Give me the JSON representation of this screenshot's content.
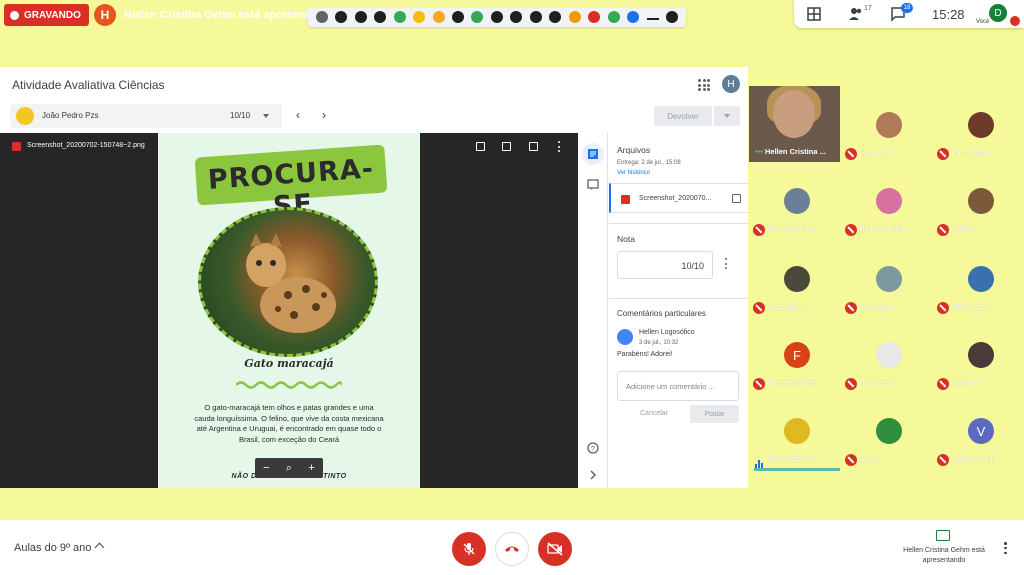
{
  "top_bar": {
    "recording_label": "GRAVANDO",
    "presenter_initial": "H",
    "presenting_text": "Hellen Cristina Gehm está apresentando",
    "participants_count": "17",
    "chat_count": "18",
    "time": "15:28",
    "you_initial": "D",
    "you_label": "Você"
  },
  "classroom": {
    "title": "Atividade Avaliativa Ciências",
    "account_initial": "H",
    "student_name": "João Pedro Pzs",
    "student_grade": "10/10",
    "return_label": "Devolver"
  },
  "viewer": {
    "file_name": "Screenshot_20200702-150748~2.png",
    "poster_title": "PROCURA-SE",
    "poster_subtitle": "Gato maracajá",
    "poster_text": "O gato-maracajá tem olhos e patas grandes e uma cauda longuíssima. O felino, que vive da costa mexicana até Argentina e Uruguai, é encontrado em quase todo o Brasil, com exceção do Ceará",
    "poster_footer": "NÃO DEIXE ELE SER EXTINTO",
    "zoom_out": "−",
    "zoom_icon": "⌕",
    "zoom_in": "+"
  },
  "panel": {
    "files_heading": "Arquivos",
    "delivered": "Entrega: 2 de jul., 15:08",
    "history_link": "Ver histórico",
    "file_chip_name": "Screenshot_2020070...",
    "grade_heading": "Nota",
    "grade_value": "10/10",
    "comments_heading": "Comentários particulares",
    "comment_author": "Hellen Logosófico",
    "comment_date": "3 de jul., 10:32",
    "comment_text": "Parabéns! Adorei!",
    "comment_placeholder": "Adicione um comentário ...",
    "cancel_label": "Cancelar",
    "post_label": "Postar"
  },
  "self_tile": {
    "name": "Hellen Cristina ..."
  },
  "participants": [
    {
      "name": "Hugo Pilar",
      "muted": true,
      "color": "#b07a5a"
    },
    {
      "name": "Paulo Maria",
      "muted": true,
      "color": "#6e3a2a"
    },
    {
      "name": "Fernanda Ague...",
      "muted": true,
      "color": "#6b8096"
    },
    {
      "name": "Barbosa Rumil",
      "muted": true,
      "color": "#d870a0"
    },
    {
      "name": "mobile",
      "muted": true,
      "color": "#7a5a3a"
    },
    {
      "name": "Lucas Bastal...",
      "muted": true,
      "color": "#4a4a3a"
    },
    {
      "name": "Igor quarto",
      "muted": true,
      "color": "#7a9aa0"
    },
    {
      "name": "João marco",
      "muted": true,
      "color": "#3a6fb0"
    },
    {
      "name": "Frederico Sales...",
      "muted": true,
      "color": "#d84315",
      "initial": "F"
    },
    {
      "name": "Bernardeira",
      "muted": true,
      "color": "#e8e8e8"
    },
    {
      "name": "Laura Fit",
      "muted": true,
      "color": "#4a3a3a"
    },
    {
      "name": "João Pedro Pzs",
      "muted": false,
      "speaking": true,
      "color": "#e0b820"
    },
    {
      "name": "A Luiz",
      "muted": true,
      "color": "#2f8f3f"
    },
    {
      "name": "Valentina Aldo",
      "muted": true,
      "color": "#5c6bc0",
      "initial": "V"
    }
  ],
  "bottom_bar": {
    "meeting_name": "Aulas do 9º ano",
    "presenting_info": "Hellen Cristina Gehm está apresentando"
  }
}
